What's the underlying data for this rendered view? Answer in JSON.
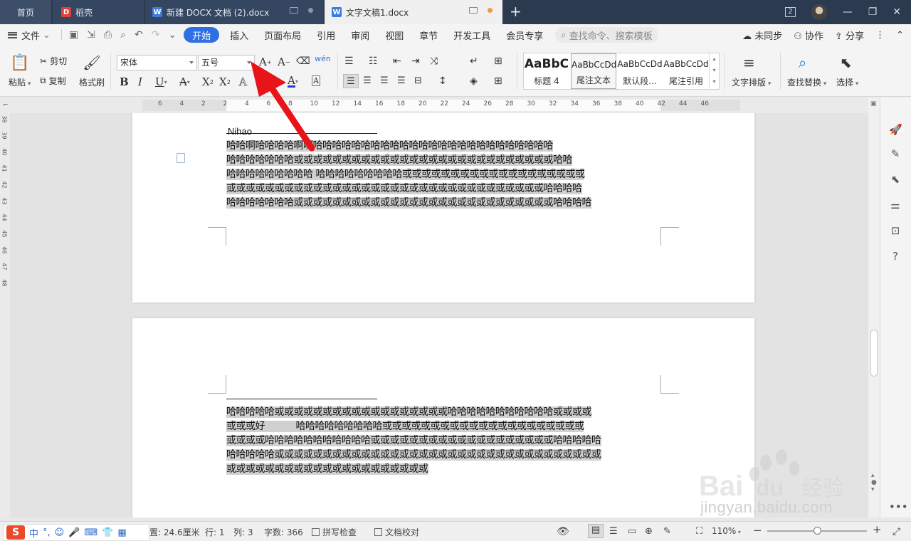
{
  "tabs": {
    "home": "首页",
    "daoke": "稻壳",
    "doc2": "新建 DOCX 文档 (2).docx",
    "doc1": "文字文稿1.docx",
    "new_tab": "+",
    "window_count": "2"
  },
  "menu": {
    "file": "文件",
    "items": [
      "开始",
      "插入",
      "页面布局",
      "引用",
      "审阅",
      "视图",
      "章节",
      "开发工具",
      "会员专享"
    ],
    "search_placeholder": "查找命令、搜索模板",
    "sync": "未同步",
    "collab": "协作",
    "share": "分享"
  },
  "ribbon": {
    "paste": "粘贴",
    "cut": "剪切",
    "copy": "复制",
    "format_painter": "格式刷",
    "font_name": "宋体",
    "font_size": "五号",
    "styles": [
      {
        "preview": "AaBbC",
        "name": "标题 4"
      },
      {
        "preview": "AaBbCcDd",
        "name": "尾注文本"
      },
      {
        "preview": "AaBbCcDd",
        "name": "默认段..."
      },
      {
        "preview": "AaBbCcDd",
        "name": "尾注引用"
      }
    ],
    "text_layout": "文字排版",
    "find_replace": "查找替换",
    "select": "选择"
  },
  "ruler": {
    "h_ticks": [
      "6",
      "4",
      "2",
      "2",
      "4",
      "6",
      "8",
      "10",
      "12",
      "14",
      "16",
      "18",
      "20",
      "22",
      "24",
      "26",
      "28",
      "30",
      "32",
      "34",
      "36",
      "38",
      "40",
      "42",
      "44",
      "46"
    ],
    "v_ticks": [
      "38",
      "39",
      "40",
      "41",
      "42",
      "43",
      "44",
      "45",
      "46",
      "47",
      "48"
    ]
  },
  "document": {
    "page1_header": "Nihao",
    "page1_lines": [
      "哈哈啊哈哈哈哈啊啊哈哈哈哈哈哈哈哈哈哈哈哈哈哈哈哈哈哈哈哈哈哈哈哈哈",
      "哈哈哈哈哈哈哈或或或或或或或或或或或或或或或或或或或或或或或或或或或哈哈",
      "哈哈哈哈哈哈哈哈哈 哈哈哈哈哈哈哈哈哈或或或或或或或或或或或或或或或或或或或",
      "或或或或或或或或或或或或或或或或或或或或或或或或或或或或或或或或或哈哈哈哈",
      "哈哈哈哈哈哈哈或或或或或或或或或或或或或或或或或或或或或或或或或或或哈哈哈哈"
    ],
    "page2_lines": [
      "哈哈哈哈哈或或或或或或或或或或或或或或或或或或哈哈哈哈哈哈哈哈哈哈哈或或或或",
      "或或或好           哈哈哈哈哈哈哈哈哈或或或或或或或或或或或或或或或或或或或或或",
      "或或或或哈哈哈哈哈哈哈哈哈哈哈或或或或或或或或或或或或或或或或或或或哈哈哈哈哈",
      "哈哈哈哈哈或或或或或或或或或或或或或或或或或或或或或或或或或或或或或或或或或或",
      "或或或或或或或或或或或或或或或或或或或或或"
    ]
  },
  "status": {
    "position": "置: 24.6厘米",
    "row": "行: 1",
    "col": "列: 3",
    "word_count": "字数: 366",
    "spell_check": "拼写检查",
    "doc_check": "文档校对",
    "zoom": "110%"
  },
  "ime": {
    "logo": "S",
    "mode": "中"
  },
  "watermark": {
    "text": "jingyan.baidu.com",
    "brand": "Bai",
    "brand2": "du",
    "suffix": "经验"
  },
  "colors": {
    "accent": "#2e6fe2",
    "tabbar": "#2b3a4f",
    "highlight": "#d0d0d0",
    "arrow": "#e8141a"
  },
  "zoom_level": 0.5
}
